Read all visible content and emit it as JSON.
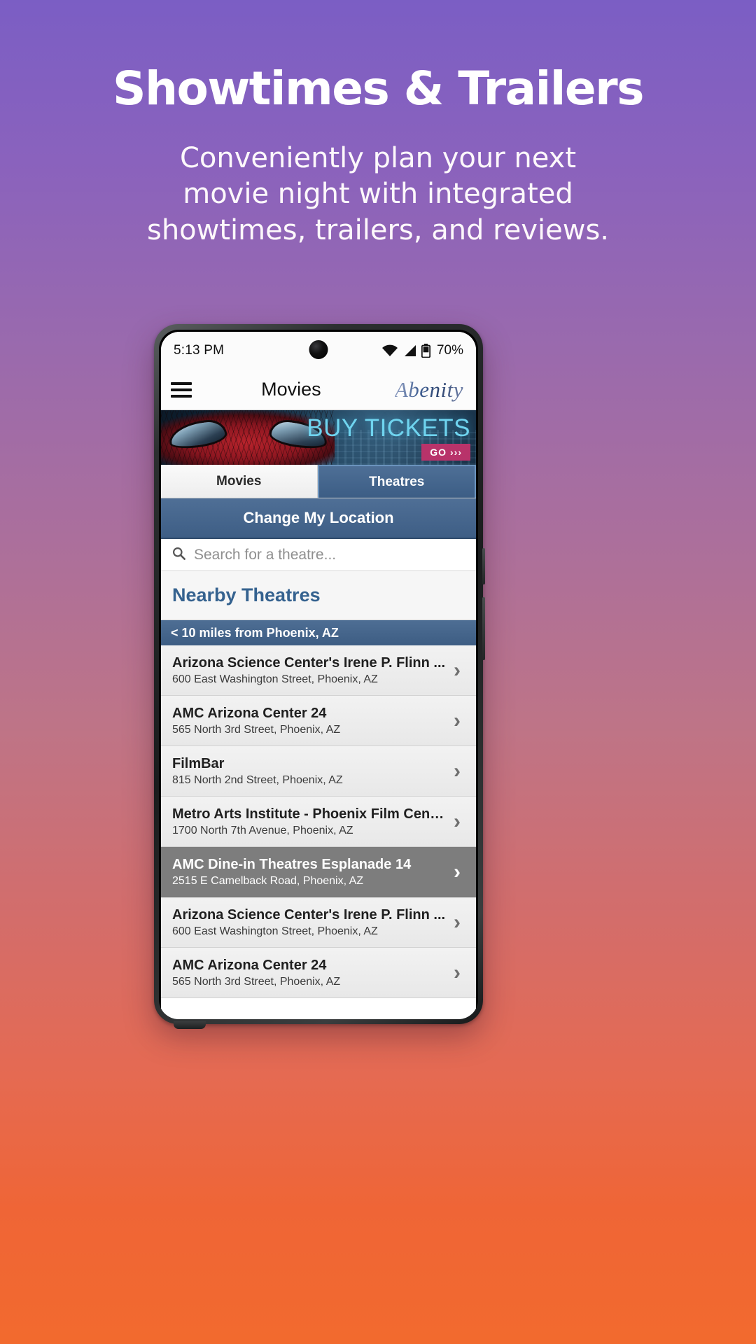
{
  "promo": {
    "title": "Showtimes & Trailers",
    "subtitle_lines": [
      "Conveniently plan your next",
      "movie night with integrated",
      "showtimes, trailers, and reviews."
    ]
  },
  "status_bar": {
    "time": "5:13 PM",
    "battery_percent": "70%",
    "icons": [
      "wifi-icon",
      "cellular-signal-icon",
      "battery-icon"
    ]
  },
  "app_header": {
    "menu_icon": "hamburger-menu-icon",
    "title": "Movies",
    "brand": "Abenity"
  },
  "banner": {
    "headline": "BUY TICKETS",
    "cta_label": "GO",
    "cta_arrows": "›››"
  },
  "tabs": [
    {
      "label": "Movies",
      "active": false
    },
    {
      "label": "Theatres",
      "active": true
    }
  ],
  "change_location": {
    "label": "Change My Location"
  },
  "search": {
    "icon": "search-icon",
    "placeholder": "Search for a theatre..."
  },
  "nearby": {
    "heading": "Nearby Theatres"
  },
  "distance_header": {
    "label": "< 10 miles from Phoenix, AZ"
  },
  "theatres": [
    {
      "name": "Arizona Science Center's Irene P. Flinn ...",
      "address": "600 East Washington Street, Phoenix, AZ",
      "selected": false
    },
    {
      "name": "AMC Arizona Center 24",
      "address": "565 North 3rd Street, Phoenix, AZ",
      "selected": false
    },
    {
      "name": "FilmBar",
      "address": "815 North 2nd Street, Phoenix, AZ",
      "selected": false
    },
    {
      "name": "Metro Arts Institute - Phoenix Film Center",
      "address": "1700 North 7th Avenue, Phoenix, AZ",
      "selected": false
    },
    {
      "name": "AMC Dine-in Theatres Esplanade 14",
      "address": "2515 E Camelback Road, Phoenix, AZ",
      "selected": true
    },
    {
      "name": "Arizona Science Center's Irene P. Flinn ...",
      "address": "600 East Washington Street, Phoenix, AZ",
      "selected": false
    },
    {
      "name": "AMC Arizona Center 24",
      "address": "565 North 3rd Street, Phoenix, AZ",
      "selected": false
    }
  ],
  "colors": {
    "accent_blue": "#3e5e85",
    "heading_blue": "#35628f",
    "banner_cyan": "#6fd4ef",
    "cta_pink": "#b8336a",
    "selected_row": "#7d7d7d",
    "bg_top": "#7b5ec4",
    "bg_bottom": "#f26a2e"
  }
}
